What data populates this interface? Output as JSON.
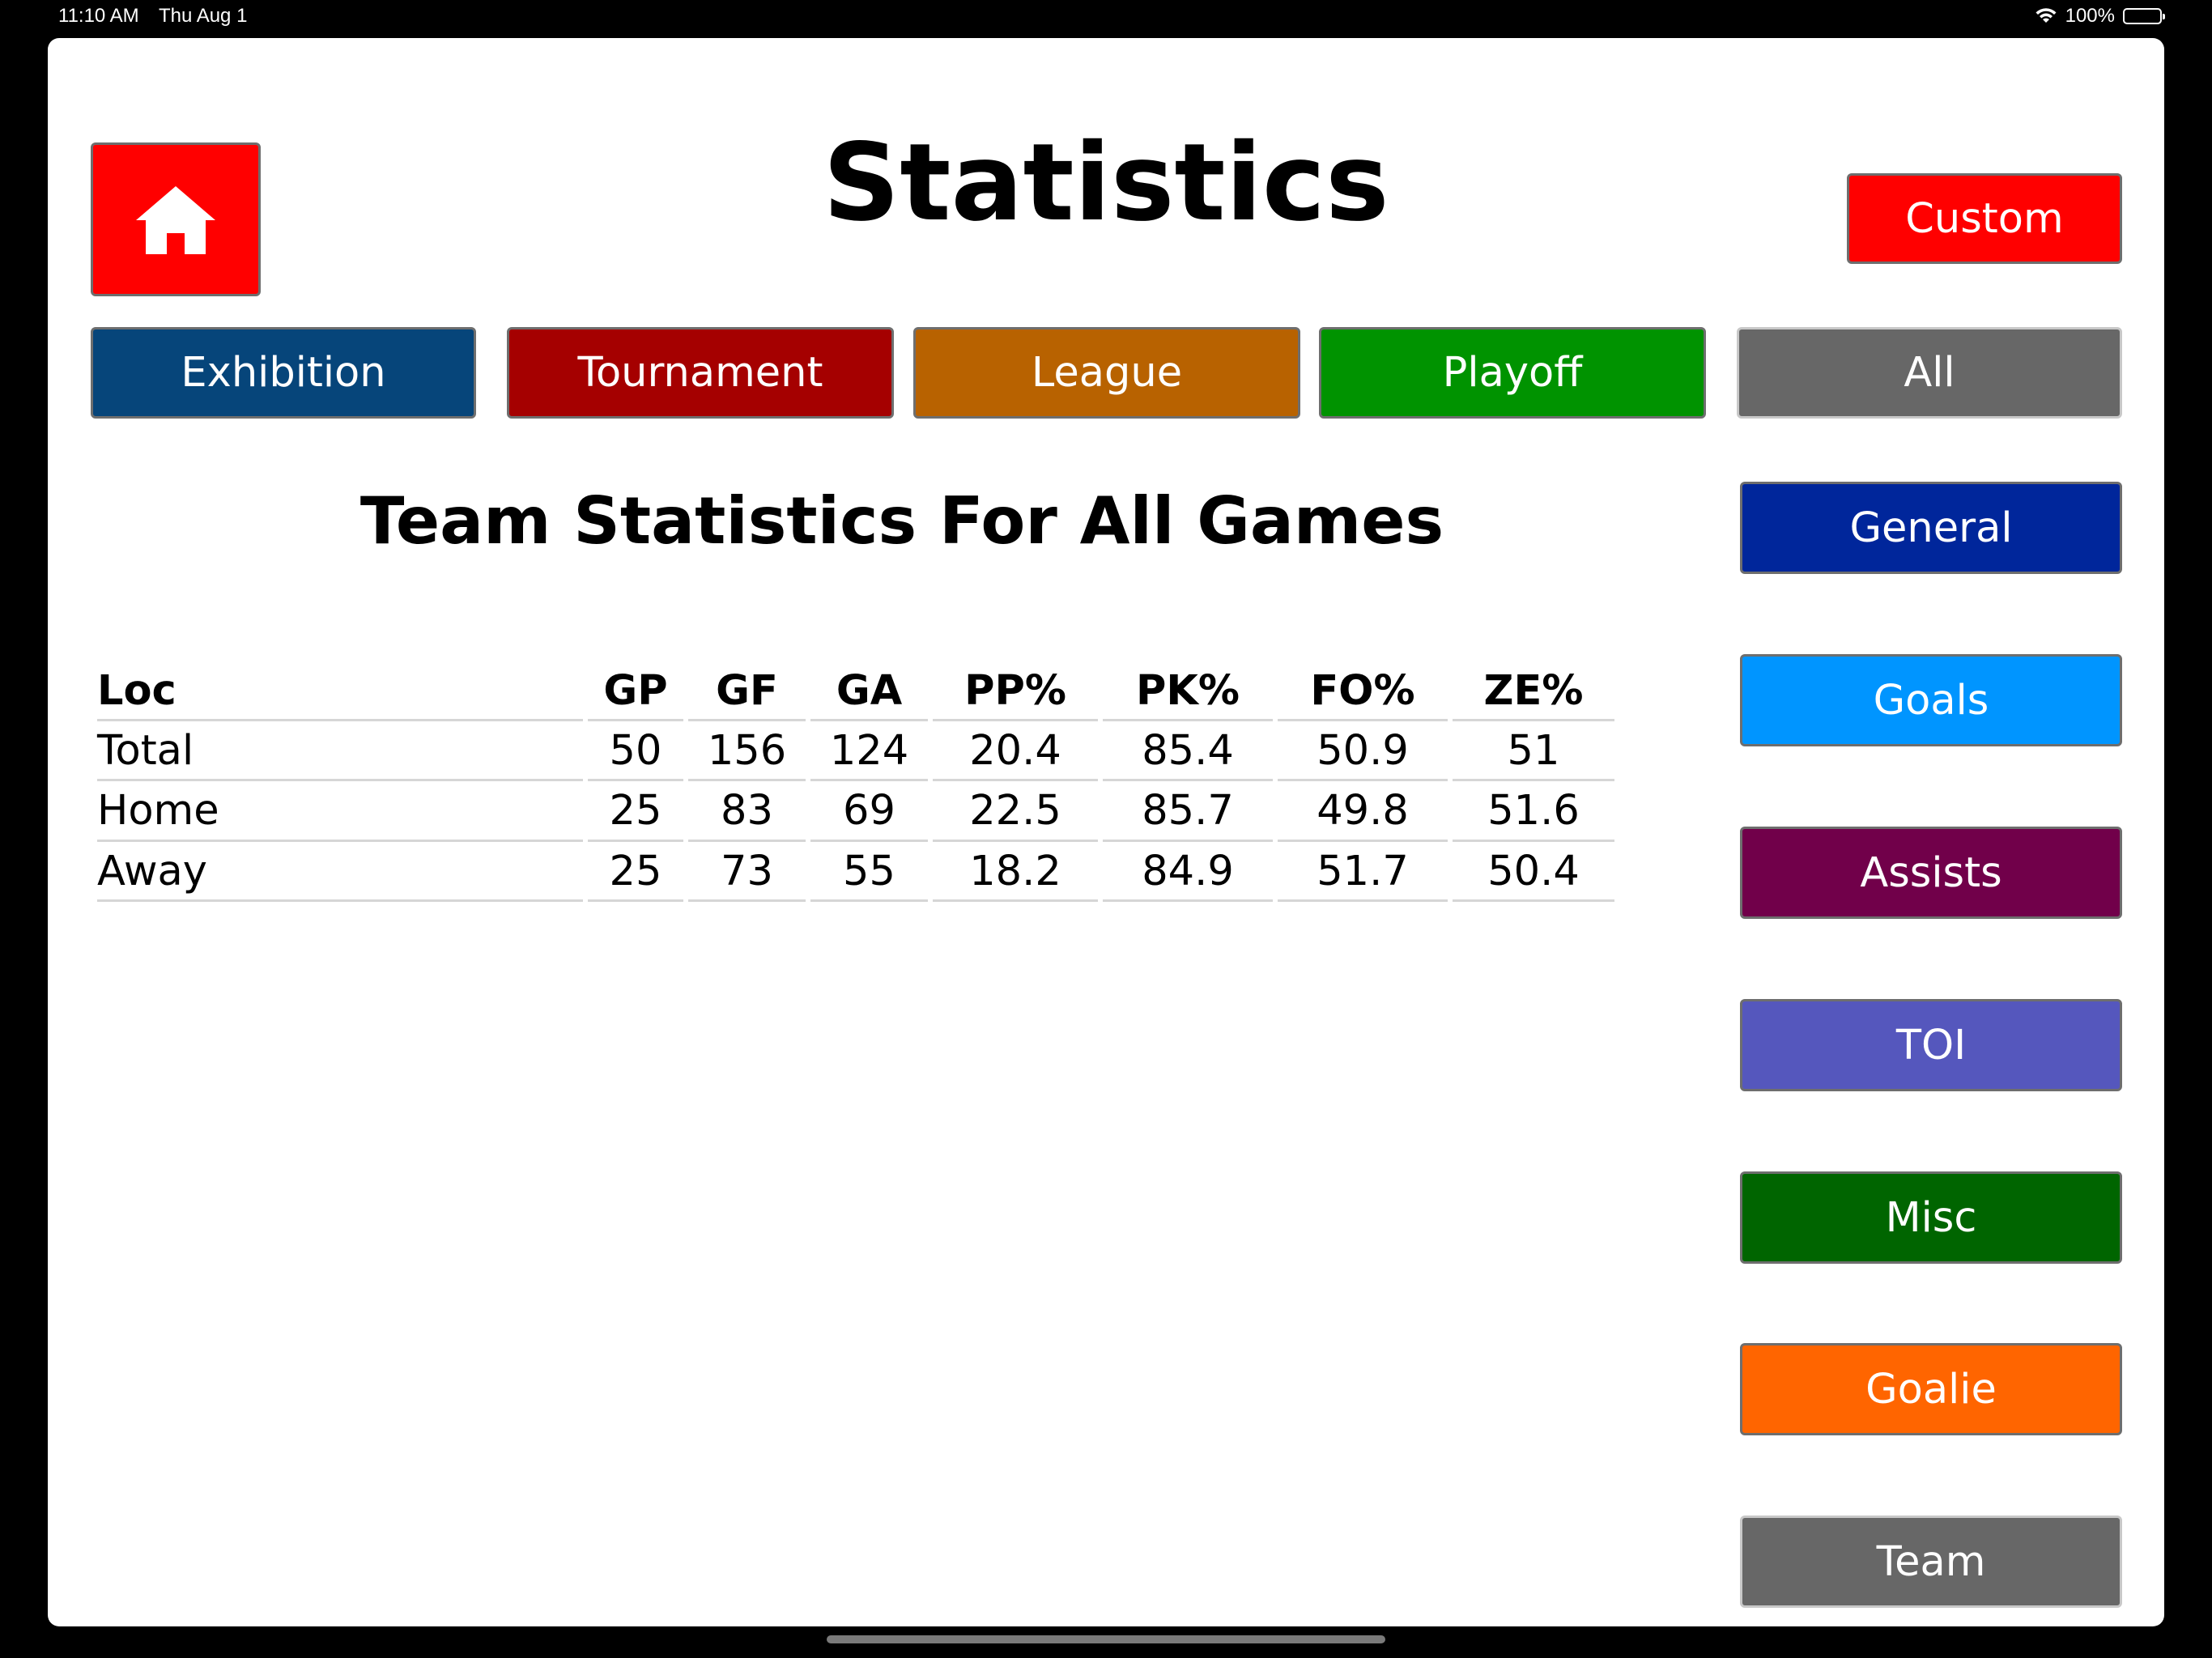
{
  "status_bar": {
    "time": "11:10 AM",
    "date": "Thu Aug 1",
    "battery": "100%",
    "icons": [
      "wifi-icon",
      "battery-icon"
    ]
  },
  "header": {
    "title": "Statistics",
    "home_icon": "home-icon",
    "custom_label": "Custom"
  },
  "filters": {
    "exhibition": "Exhibition",
    "tournament": "Tournament",
    "league": "League",
    "playoff": "Playoff",
    "all": "All"
  },
  "side_menu": {
    "general": "General",
    "goals": "Goals",
    "assists": "Assists",
    "toi": "TOI",
    "misc": "Misc",
    "goalie": "Goalie",
    "team": "Team"
  },
  "section_title": "Team Statistics For All Games",
  "table": {
    "columns": [
      "Loc",
      "GP",
      "GF",
      "GA",
      "PP%",
      "PK%",
      "FO%",
      "ZE%"
    ],
    "rows": [
      [
        "Total",
        "50",
        "156",
        "124",
        "20.4",
        "85.4",
        "50.9",
        "51"
      ],
      [
        "Home",
        "25",
        "83",
        "69",
        "22.5",
        "85.7",
        "49.8",
        "51.6"
      ],
      [
        "Away",
        "25",
        "73",
        "55",
        "18.2",
        "84.9",
        "51.7",
        "50.4"
      ]
    ]
  },
  "colors": {
    "home_button": "#ff0000",
    "custom_button": "#ff0000",
    "exhibition": "#06457a",
    "tournament": "#a50000",
    "league": "#b86200",
    "playoff": "#009300",
    "all": "#676767",
    "general": "#00269b",
    "goals": "#0095ff",
    "assists": "#71004a",
    "toi": "#5557bd",
    "misc": "#006500",
    "goalie": "#ff6500",
    "team": "#676767"
  }
}
